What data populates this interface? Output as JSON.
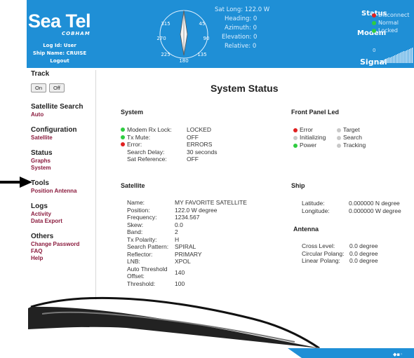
{
  "header": {
    "logo": "Sea Tel",
    "logo_sub": "COBHAM",
    "log_id": "Log Id: User",
    "ship_name": "Ship Name: CRUISE",
    "logout": "Logout",
    "compass": {
      "labels": [
        "315",
        "45",
        "270",
        "90",
        "225",
        "135",
        "180"
      ],
      "heading_needle_deg": 0
    },
    "readouts": [
      "Sat Long: 122.0 W",
      "Heading: 0",
      "Azimuth: 0",
      "Elevation: 0",
      "Relative: 0"
    ],
    "status_label": "Status",
    "status_items": [
      {
        "text": "Disconnect",
        "color": "#e02020"
      },
      {
        "text": "Normal",
        "color": "#2ecc40"
      }
    ],
    "modem_label": "Modem",
    "modem_items": [
      {
        "text": "Locked",
        "color": "#2ecc40"
      }
    ],
    "signal_label": "Signal",
    "signal_value": "0"
  },
  "sidebar": {
    "track": "Track",
    "track_on": "On",
    "track_off": "Off",
    "sat_search": "Satellite Search",
    "sat_search_auto": "Auto",
    "configuration": "Configuration",
    "configuration_satellite": "Satellite",
    "status": "Status",
    "status_graphs": "Graphs",
    "status_system": "System",
    "tools": "Tools",
    "tools_position": "Position Antenna",
    "logs": "Logs",
    "logs_activity": "Activity",
    "logs_export": "Data Export",
    "others": "Others",
    "others_password": "Change Password",
    "others_faq": "FAQ",
    "others_help": "Help"
  },
  "main": {
    "title": "System Status",
    "system": {
      "title": "System",
      "rows": [
        {
          "dot": "#2ecc40",
          "key": "Modem Rx Lock:",
          "value": "LOCKED"
        },
        {
          "dot": "#2ecc40",
          "key": "Tx Mute:",
          "value": "OFF"
        },
        {
          "dot": "#e02020",
          "key": "Error:",
          "value": "ERRORS"
        },
        {
          "dot": "",
          "key": "Search Delay:",
          "value": "30 seconds"
        },
        {
          "dot": "",
          "key": "Sat Reference:",
          "value": "OFF"
        }
      ]
    },
    "front_panel": {
      "title": "Front Panel Led",
      "left": [
        {
          "dot": "#e02020",
          "label": "Error"
        },
        {
          "dot": "#c8c8c8",
          "label": "Initializing"
        },
        {
          "dot": "#2ecc40",
          "label": "Power"
        }
      ],
      "right": [
        {
          "dot": "#c8c8c8",
          "label": "Target"
        },
        {
          "dot": "#c8c8c8",
          "label": "Search"
        },
        {
          "dot": "#c8c8c8",
          "label": "Tracking"
        }
      ]
    },
    "satellite": {
      "title": "Satellite",
      "rows": [
        {
          "key": "Name:",
          "value": "MY FAVORITE SATELLITE"
        },
        {
          "key": "Position:",
          "value": "122.0 W degree"
        },
        {
          "key": "Frequency:",
          "value": "1234.567"
        },
        {
          "key": "Skew:",
          "value": "0.0"
        },
        {
          "key": "Band:",
          "value": "2"
        },
        {
          "key": "Tx Polarity:",
          "value": "H"
        },
        {
          "key": "Search Pattern:",
          "value": "SPIRAL"
        },
        {
          "key": "Reflector:",
          "value": "PRIMARY"
        },
        {
          "key": "LNB:",
          "value": "XPOL"
        },
        {
          "key": "Auto Threshold Offset:",
          "value": "140"
        },
        {
          "key": "Threshold:",
          "value": "100"
        }
      ]
    },
    "ship": {
      "title": "Ship",
      "rows": [
        {
          "key": "Latitude:",
          "value": "0.000000 N degree"
        },
        {
          "key": "Longitude:",
          "value": "0.000000 W degree"
        }
      ]
    },
    "antenna": {
      "title": "Antenna",
      "rows": [
        {
          "key": "Cross Level:",
          "value": "0.0 degree"
        },
        {
          "key": "Circular Polang:",
          "value": "0.0 degree"
        },
        {
          "key": "Linear Polang:",
          "value": "0.0 degree"
        }
      ]
    }
  },
  "colors": {
    "header_bg": "#1f8fd6",
    "link": "#8b1c3e",
    "green": "#2ecc40",
    "red": "#e02020",
    "grey": "#c8c8c8"
  }
}
